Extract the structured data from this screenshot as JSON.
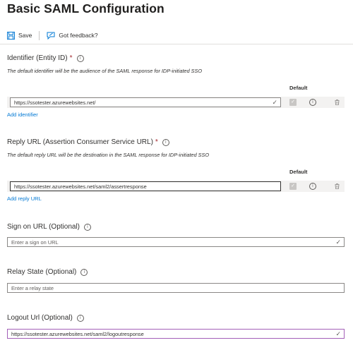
{
  "header": {
    "title": "Basic SAML Configuration"
  },
  "toolbar": {
    "save_label": "Save",
    "feedback_label": "Got feedback?"
  },
  "identifier": {
    "label": "Identifier (Entity ID)",
    "required_mark": "*",
    "description": "The default identifier will be the audience of the SAML response for IDP-initiated SSO",
    "default_header": "Default",
    "value": "https://ssotester.azurewebsites.net/",
    "add_link": "Add identifier"
  },
  "reply_url": {
    "label": "Reply URL (Assertion Consumer Service URL)",
    "required_mark": "*",
    "description": "The default reply URL will be the destination in the SAML response for IDP-initiated SSO",
    "default_header": "Default",
    "value": "https://ssotester.azurewebsites.net/saml2/assertresponse",
    "add_link": "Add reply URL"
  },
  "sign_on_url": {
    "label": "Sign on URL (Optional)",
    "placeholder": "Enter a sign on URL"
  },
  "relay_state": {
    "label": "Relay State (Optional)",
    "placeholder": "Enter a relay state"
  },
  "logout_url": {
    "label": "Logout Url (Optional)",
    "value": "https://ssotester.azurewebsites.net/saml2/logoutresponse"
  },
  "icons": {
    "save": "save-icon",
    "feedback": "feedback-icon",
    "info": "info-icon",
    "check": "checkmark-icon",
    "delete": "trash-icon"
  },
  "colors": {
    "link": "#0078d4",
    "required": "#a4262c",
    "logout_border": "#a35fb8"
  }
}
